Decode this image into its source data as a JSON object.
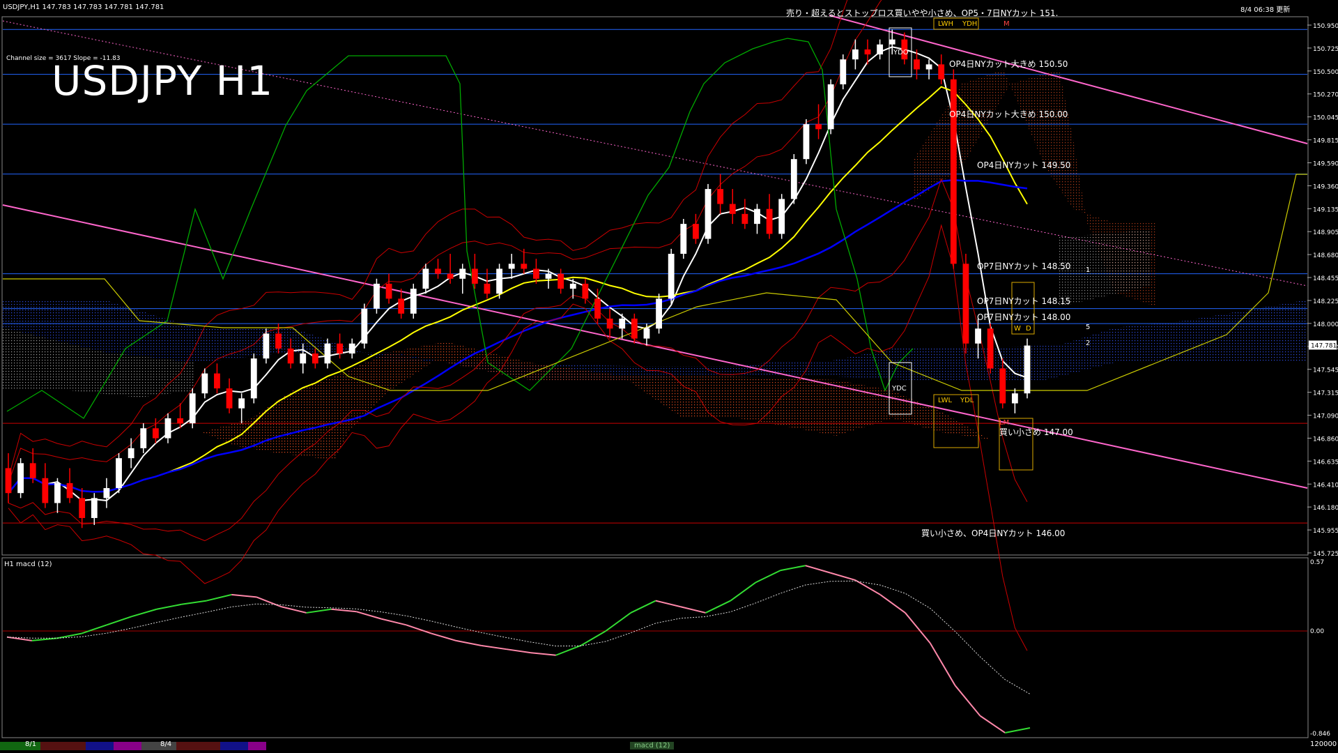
{
  "header": {
    "symbol_info": "USDJPY,H1  147.783 147.783 147.781 147.781",
    "timestamp": "8/4 06:38 更新",
    "channel_info": "Channel size = 3617 Slope = -11.83",
    "big_title": "USDJPY H1",
    "top_comment": "売り・超えるとストップロス買いやや小さめ、OP5・7日NYカット 151."
  },
  "annotations": [
    {
      "id": "op4-150-50",
      "text": "OP4日NYカット大きめ 150.50",
      "price": 150.5
    },
    {
      "id": "op4-150-00",
      "text": "OP4日NYカット大きめ 150.00",
      "price": 150.0
    },
    {
      "id": "op4-149-50",
      "text": "OP4日NYカット 149.50",
      "price": 149.5
    },
    {
      "id": "op7-148-50",
      "text": "OP7日NYカット 148.50",
      "price": 148.5
    },
    {
      "id": "op7-148-15",
      "text": "OP7日NYカット 148.15",
      "price": 148.15
    },
    {
      "id": "op7-148-00",
      "text": "OP7日NYカット 148.00",
      "price": 148.0
    },
    {
      "id": "buy-147-00",
      "text": "買い小さめ 147.00",
      "price": 147.0
    },
    {
      "id": "buy-146-00",
      "text": "買い小さめ、OP4日NYカット 146.00",
      "price": 146.0
    }
  ],
  "box_labels": {
    "ydo": "YDO",
    "ydh": "YDH",
    "lwh": "LWH",
    "ydc": "YDC",
    "lwl": "LWL",
    "ydl": "YDL",
    "w": "W",
    "d": "D",
    "m": "M",
    "lm": "LM",
    "ch1": "1",
    "ch2": "2",
    "ch5": "5"
  },
  "macd_panel": {
    "label": "H1  macd (12)",
    "top_value": "0.57",
    "zero_value": "0.00",
    "bottom_value": "-0.846"
  },
  "bottom_bar": {
    "date1": "8/1",
    "date2": "8/4",
    "tab_label": "macd (12)",
    "volume_label": "120000"
  },
  "price_axis": {
    "current_price": "147.781",
    "ticks": [
      "150.950",
      "150.725",
      "150.500",
      "150.270",
      "150.045",
      "149.815",
      "149.590",
      "149.360",
      "149.135",
      "148.905",
      "148.680",
      "148.455",
      "148.225",
      "148.000",
      "147.770",
      "147.545",
      "147.315",
      "147.090",
      "146.860",
      "146.635",
      "146.410",
      "146.180",
      "145.955",
      "145.725"
    ]
  },
  "colors": {
    "bull_candle": "#ffffff",
    "bear_candle": "#ff0000",
    "ma_white": "#ffffff",
    "ma_yellow": "#ffff00",
    "ma_blue": "#0000ff",
    "bollinger": "#cc0000",
    "channel": "#ff66cc",
    "chikou": "#00aa00",
    "kumo_bull": "#3355ff",
    "kumo_bear": "#ff5522",
    "grid_h": "#2266ff",
    "macd_up": "#33dd33",
    "macd_down": "#ff88aa"
  },
  "chart_data": {
    "type": "candlestick",
    "title": "USDJPY H1",
    "ylim": [
      145.7,
      151.05
    ],
    "candles": [
      {
        "o": 146.55,
        "h": 146.7,
        "l": 146.2,
        "c": 146.3
      },
      {
        "o": 146.3,
        "h": 146.65,
        "l": 146.25,
        "c": 146.6
      },
      {
        "o": 146.6,
        "h": 146.75,
        "l": 146.4,
        "c": 146.45
      },
      {
        "o": 146.45,
        "h": 146.6,
        "l": 146.15,
        "c": 146.2
      },
      {
        "o": 146.2,
        "h": 146.45,
        "l": 146.1,
        "c": 146.4
      },
      {
        "o": 146.4,
        "h": 146.55,
        "l": 146.2,
        "c": 146.25
      },
      {
        "o": 146.25,
        "h": 146.35,
        "l": 145.95,
        "c": 146.05
      },
      {
        "o": 146.05,
        "h": 146.3,
        "l": 145.98,
        "c": 146.25
      },
      {
        "o": 146.25,
        "h": 146.45,
        "l": 146.15,
        "c": 146.35
      },
      {
        "o": 146.35,
        "h": 146.7,
        "l": 146.3,
        "c": 146.65
      },
      {
        "o": 146.65,
        "h": 146.85,
        "l": 146.55,
        "c": 146.75
      },
      {
        "o": 146.75,
        "h": 147.0,
        "l": 146.7,
        "c": 146.95
      },
      {
        "o": 146.95,
        "h": 147.05,
        "l": 146.8,
        "c": 146.85
      },
      {
        "o": 146.85,
        "h": 147.1,
        "l": 146.8,
        "c": 147.05
      },
      {
        "o": 147.05,
        "h": 147.2,
        "l": 146.95,
        "c": 147.0
      },
      {
        "o": 147.0,
        "h": 147.35,
        "l": 146.95,
        "c": 147.3
      },
      {
        "o": 147.3,
        "h": 147.55,
        "l": 147.25,
        "c": 147.5
      },
      {
        "o": 147.5,
        "h": 147.6,
        "l": 147.3,
        "c": 147.35
      },
      {
        "o": 147.35,
        "h": 147.45,
        "l": 147.1,
        "c": 147.15
      },
      {
        "o": 147.15,
        "h": 147.3,
        "l": 147.0,
        "c": 147.25
      },
      {
        "o": 147.25,
        "h": 147.7,
        "l": 147.2,
        "c": 147.65
      },
      {
        "o": 147.65,
        "h": 147.95,
        "l": 147.6,
        "c": 147.9
      },
      {
        "o": 147.9,
        "h": 148.0,
        "l": 147.7,
        "c": 147.75
      },
      {
        "o": 147.75,
        "h": 147.85,
        "l": 147.55,
        "c": 147.6
      },
      {
        "o": 147.6,
        "h": 147.8,
        "l": 147.5,
        "c": 147.7
      },
      {
        "o": 147.7,
        "h": 147.75,
        "l": 147.55,
        "c": 147.6
      },
      {
        "o": 147.6,
        "h": 147.85,
        "l": 147.55,
        "c": 147.8
      },
      {
        "o": 147.8,
        "h": 147.9,
        "l": 147.65,
        "c": 147.7
      },
      {
        "o": 147.7,
        "h": 147.85,
        "l": 147.65,
        "c": 147.8
      },
      {
        "o": 147.8,
        "h": 148.2,
        "l": 147.75,
        "c": 148.15
      },
      {
        "o": 148.15,
        "h": 148.45,
        "l": 148.1,
        "c": 148.4
      },
      {
        "o": 148.4,
        "h": 148.5,
        "l": 148.2,
        "c": 148.25
      },
      {
        "o": 148.25,
        "h": 148.35,
        "l": 148.05,
        "c": 148.1
      },
      {
        "o": 148.1,
        "h": 148.4,
        "l": 148.05,
        "c": 148.35
      },
      {
        "o": 148.35,
        "h": 148.6,
        "l": 148.3,
        "c": 148.55
      },
      {
        "o": 148.55,
        "h": 148.65,
        "l": 148.45,
        "c": 148.5
      },
      {
        "o": 148.5,
        "h": 148.7,
        "l": 148.4,
        "c": 148.45
      },
      {
        "o": 148.45,
        "h": 148.6,
        "l": 148.3,
        "c": 148.55
      },
      {
        "o": 148.55,
        "h": 148.7,
        "l": 148.35,
        "c": 148.4
      },
      {
        "o": 148.4,
        "h": 148.55,
        "l": 148.25,
        "c": 148.3
      },
      {
        "o": 148.3,
        "h": 148.6,
        "l": 148.25,
        "c": 148.55
      },
      {
        "o": 148.55,
        "h": 148.7,
        "l": 148.45,
        "c": 148.6
      },
      {
        "o": 148.6,
        "h": 148.75,
        "l": 148.5,
        "c": 148.55
      },
      {
        "o": 148.55,
        "h": 148.65,
        "l": 148.4,
        "c": 148.45
      },
      {
        "o": 148.45,
        "h": 148.55,
        "l": 148.35,
        "c": 148.5
      },
      {
        "o": 148.5,
        "h": 148.55,
        "l": 148.3,
        "c": 148.35
      },
      {
        "o": 148.35,
        "h": 148.45,
        "l": 148.25,
        "c": 148.4
      },
      {
        "o": 148.4,
        "h": 148.45,
        "l": 148.2,
        "c": 148.25
      },
      {
        "o": 148.25,
        "h": 148.35,
        "l": 148.0,
        "c": 148.05
      },
      {
        "o": 148.05,
        "h": 148.15,
        "l": 147.85,
        "c": 147.95
      },
      {
        "o": 147.95,
        "h": 148.1,
        "l": 147.85,
        "c": 148.05
      },
      {
        "o": 148.05,
        "h": 148.1,
        "l": 147.8,
        "c": 147.85
      },
      {
        "o": 147.85,
        "h": 148.0,
        "l": 147.78,
        "c": 147.95
      },
      {
        "o": 147.95,
        "h": 148.3,
        "l": 147.9,
        "c": 148.25
      },
      {
        "o": 148.25,
        "h": 148.75,
        "l": 148.2,
        "c": 148.7
      },
      {
        "o": 148.7,
        "h": 149.05,
        "l": 148.65,
        "c": 149.0
      },
      {
        "o": 149.0,
        "h": 149.1,
        "l": 148.8,
        "c": 148.85
      },
      {
        "o": 148.85,
        "h": 149.4,
        "l": 148.8,
        "c": 149.35
      },
      {
        "o": 149.35,
        "h": 149.5,
        "l": 149.1,
        "c": 149.2
      },
      {
        "o": 149.2,
        "h": 149.35,
        "l": 149.0,
        "c": 149.1
      },
      {
        "o": 149.1,
        "h": 149.25,
        "l": 148.95,
        "c": 149.0
      },
      {
        "o": 149.0,
        "h": 149.2,
        "l": 148.9,
        "c": 149.15
      },
      {
        "o": 149.15,
        "h": 149.3,
        "l": 148.85,
        "c": 148.9
      },
      {
        "o": 148.9,
        "h": 149.3,
        "l": 148.85,
        "c": 149.25
      },
      {
        "o": 149.25,
        "h": 149.7,
        "l": 149.2,
        "c": 149.65
      },
      {
        "o": 149.65,
        "h": 150.05,
        "l": 149.6,
        "c": 150.0
      },
      {
        "o": 150.0,
        "h": 150.2,
        "l": 149.85,
        "c": 149.95
      },
      {
        "o": 149.95,
        "h": 150.45,
        "l": 149.9,
        "c": 150.4
      },
      {
        "o": 150.4,
        "h": 150.7,
        "l": 150.35,
        "c": 150.65
      },
      {
        "o": 150.65,
        "h": 150.85,
        "l": 150.55,
        "c": 150.75
      },
      {
        "o": 150.75,
        "h": 150.85,
        "l": 150.6,
        "c": 150.7
      },
      {
        "o": 150.7,
        "h": 150.85,
        "l": 150.65,
        "c": 150.8
      },
      {
        "o": 150.8,
        "h": 150.95,
        "l": 150.7,
        "c": 150.85
      },
      {
        "o": 150.85,
        "h": 150.92,
        "l": 150.6,
        "c": 150.65
      },
      {
        "o": 150.65,
        "h": 150.75,
        "l": 150.45,
        "c": 150.55
      },
      {
        "o": 150.55,
        "h": 150.65,
        "l": 150.45,
        "c": 150.6
      },
      {
        "o": 150.6,
        "h": 150.7,
        "l": 150.4,
        "c": 150.45
      },
      {
        "o": 150.45,
        "h": 150.55,
        "l": 148.55,
        "c": 148.6
      },
      {
        "o": 148.6,
        "h": 148.7,
        "l": 147.7,
        "c": 147.8
      },
      {
        "o": 147.8,
        "h": 148.05,
        "l": 147.65,
        "c": 147.95
      },
      {
        "o": 147.95,
        "h": 148.0,
        "l": 147.5,
        "c": 147.55
      },
      {
        "o": 147.55,
        "h": 147.65,
        "l": 147.15,
        "c": 147.2
      },
      {
        "o": 147.2,
        "h": 147.35,
        "l": 147.1,
        "c": 147.3
      },
      {
        "o": 147.3,
        "h": 147.85,
        "l": 147.25,
        "c": 147.78
      }
    ]
  }
}
